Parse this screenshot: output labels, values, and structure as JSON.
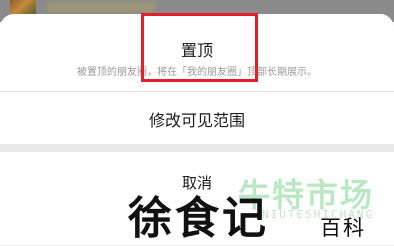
{
  "action_sheet": {
    "pin": {
      "title": "置顶",
      "description": "被置顶的朋友圈，将在「我的朋友圈」顶部长期展示。"
    },
    "edit_visibility": {
      "label": "修改可见范围"
    },
    "cancel": {
      "label": "取消"
    }
  },
  "watermarks": {
    "primary": "徐食记",
    "secondary": "百科",
    "green": "牛特市场",
    "green_sub": "NIUTESHICHANG"
  },
  "colors": {
    "highlight_box": "#e3202b",
    "sheet_bg": "#ffffff",
    "separator": "#e8e8e8"
  }
}
